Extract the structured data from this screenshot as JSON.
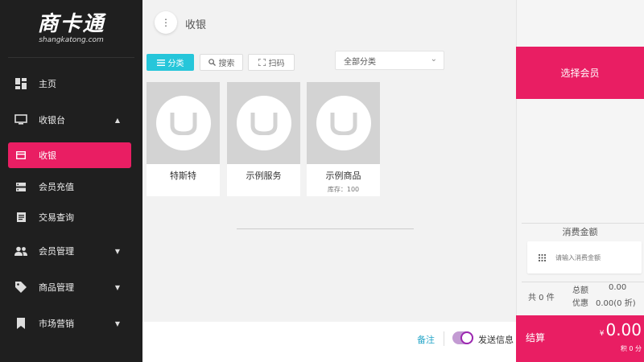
{
  "logo": {
    "main": "商卡通",
    "sub": "shangkatong.com"
  },
  "sidebar": {
    "home": "主页",
    "cashier_desk": "收银台",
    "cashier": "收银",
    "member_recharge": "会员充值",
    "transaction_query": "交易查询",
    "member_mgmt": "会员管理",
    "goods_mgmt": "商品管理",
    "marketing": "市场营销"
  },
  "header": {
    "title": "收银"
  },
  "toolbar": {
    "category": "分类",
    "search": "搜索",
    "scan": "扫码",
    "category_select": "全部分类"
  },
  "products": [
    {
      "name": "特斯特",
      "stock": ""
    },
    {
      "name": "示例服务",
      "stock": ""
    },
    {
      "name": "示例商品",
      "stock": "库存：100"
    }
  ],
  "bottom": {
    "remark": "备注",
    "send_message": "发送信息"
  },
  "right_panel": {
    "select_member": "选择会员",
    "amount_label": "消费金额",
    "amount_placeholder": "请输入消费金额",
    "count": "共 0 件",
    "total_label": "总额",
    "total_value": "0.00",
    "discount_label": "优惠",
    "discount_value": "0.00(0 折)",
    "checkout": "结算",
    "currency": "¥",
    "pay_total": "0.00",
    "points": "积 0 分"
  },
  "colors": {
    "accent": "#e91e63",
    "primary": "#26c6da",
    "sidebar_bg": "#1f1f1f"
  }
}
